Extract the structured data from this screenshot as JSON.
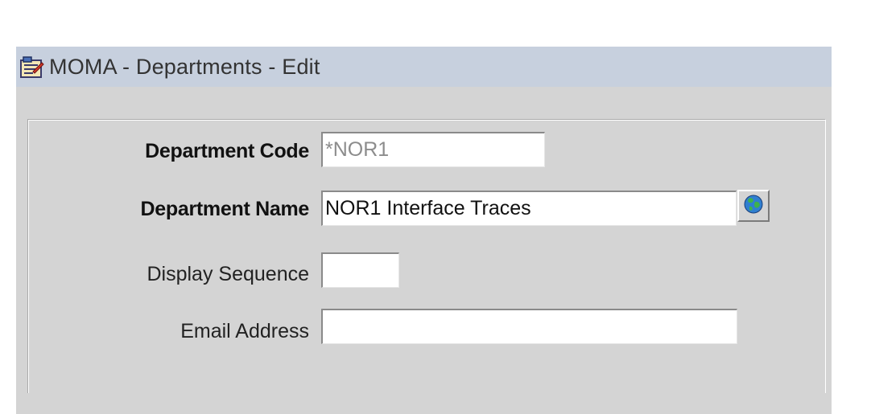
{
  "window": {
    "title": "MOMA - Departments  - Edit",
    "icon": "form-icon"
  },
  "form": {
    "department_code": {
      "label": "Department Code",
      "value": "*NOR1"
    },
    "department_name": {
      "label": "Department Name",
      "value": "NOR1 Interface Traces"
    },
    "display_sequence": {
      "label": "Display Sequence",
      "value": ""
    },
    "email_address": {
      "label": "Email Address",
      "value": ""
    },
    "lookup_button_icon": "globe-icon"
  },
  "colors": {
    "titlebar": "#c7d0de",
    "window_bg": "#d4d4d4",
    "readonly_text": "#8c8c8c"
  }
}
